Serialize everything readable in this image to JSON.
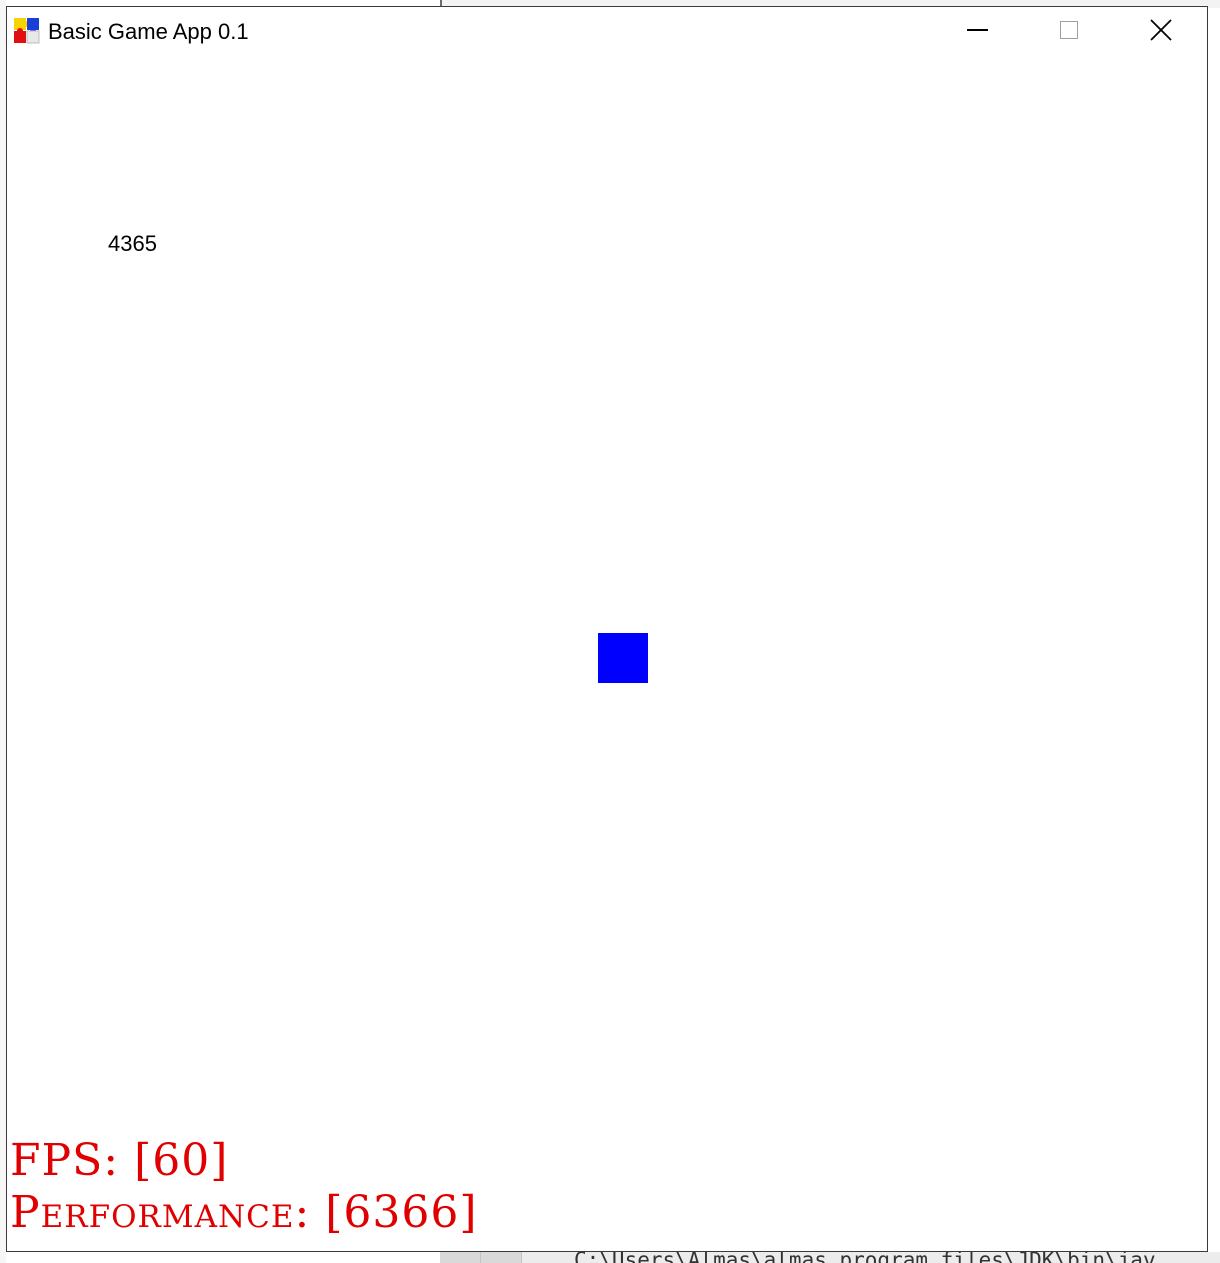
{
  "window": {
    "title": "Basic Game App 0.1",
    "icon": "puzzle-piece-icon"
  },
  "controls": {
    "minimize_icon": "minimize-icon",
    "maximize_icon": "maximize-icon",
    "close_icon": "close-icon"
  },
  "game": {
    "score": "4365",
    "player_color": "#0000ff",
    "hud_color": "#e00000",
    "fps_label": "FPS: [60]",
    "performance_label": "Performance: [6366]"
  },
  "background": {
    "console_text": "C:\\Users\\Almas\\almas program files\\JDK\\bin\\jav"
  }
}
